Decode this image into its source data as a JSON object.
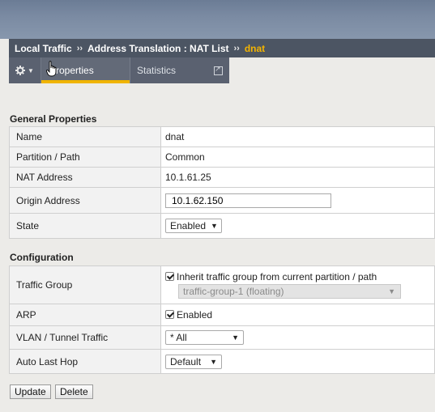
{
  "breadcrumb": {
    "level1": "Local Traffic",
    "sep": "››",
    "level2": "Address Translation : NAT List",
    "current": "dnat"
  },
  "tabs": {
    "properties": "Properties",
    "statistics": "Statistics"
  },
  "general": {
    "title": "General Properties",
    "rows": {
      "name": {
        "label": "Name",
        "value": "dnat"
      },
      "partition": {
        "label": "Partition / Path",
        "value": "Common"
      },
      "nat_address": {
        "label": "NAT Address",
        "value": "10.1.61.25"
      },
      "origin_address": {
        "label": "Origin Address",
        "value": "10.1.62.150"
      },
      "state": {
        "label": "State",
        "value": "Enabled"
      }
    }
  },
  "configuration": {
    "title": "Configuration",
    "traffic_group": {
      "label": "Traffic Group",
      "inherit_checked": true,
      "inherit_text": "Inherit traffic group from current partition / path",
      "select_value": "traffic-group-1 (floating)"
    },
    "arp": {
      "label": "ARP",
      "checked": true,
      "text": "Enabled"
    },
    "vlan": {
      "label": "VLAN / Tunnel Traffic",
      "value": "* All"
    },
    "auto_last_hop": {
      "label": "Auto Last Hop",
      "value": "Default"
    }
  },
  "buttons": {
    "update": "Update",
    "delete": "Delete"
  },
  "colors": {
    "accent": "#f0b400",
    "breadcrumb_bg": "#4c5563",
    "tab_bg": "#5a6170"
  }
}
